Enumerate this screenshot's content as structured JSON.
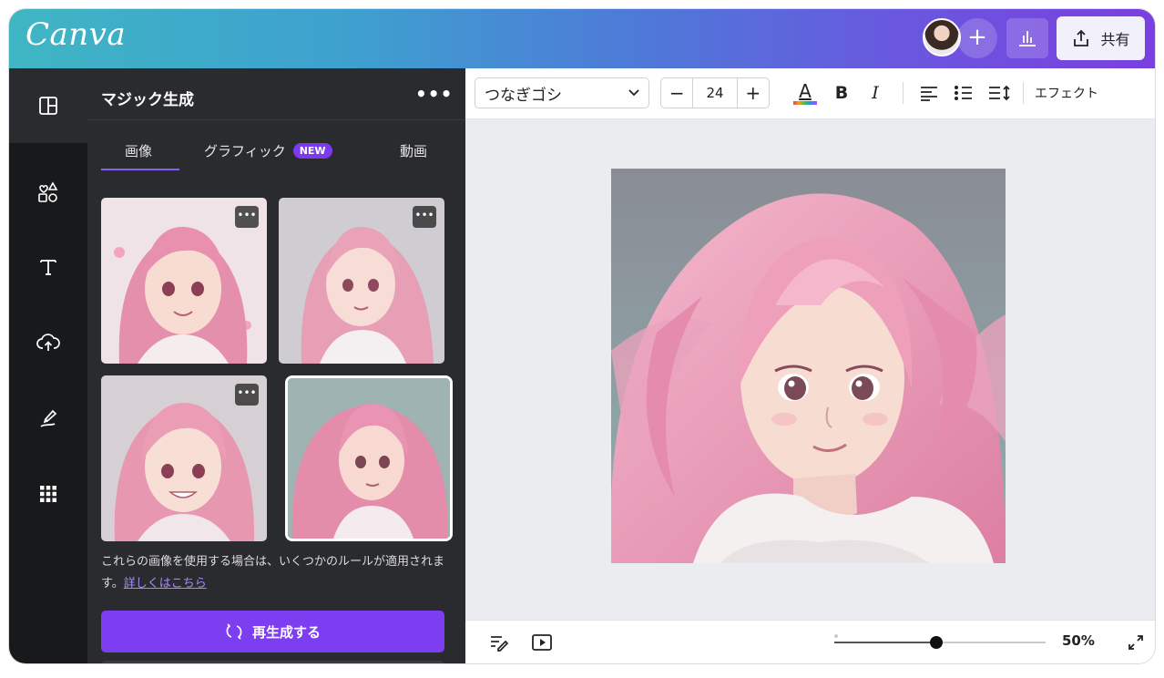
{
  "app": {
    "logo": "Canva",
    "share_label": "共有"
  },
  "panel": {
    "title": "マジック生成",
    "more": "•••",
    "tabs": [
      {
        "label": "画像"
      },
      {
        "label": "グラフィック",
        "badge": "NEW"
      },
      {
        "label": "動画"
      }
    ],
    "thumb_more": "•••",
    "disclaimer_text": "これらの画像を使用する場合は、いくつかのルールが適用されます。",
    "disclaimer_link": "詳しくはこちら",
    "regenerate_label": "再生成する"
  },
  "toolbar": {
    "font_name": "つなぎゴシ",
    "font_size": "24",
    "minus": "−",
    "plus": "+",
    "bold": "B",
    "italic": "I",
    "text_color_letter": "A",
    "effects_label": "エフェクト"
  },
  "footer": {
    "zoom": "50%",
    "zoom_fraction": 0.5
  },
  "colors": {
    "accent": "#7d3df0",
    "panel_bg": "#2a2b2e",
    "rail_bg": "#18191b"
  },
  "icons": [
    "layout-icon",
    "elements-icon",
    "text-icon",
    "upload-icon",
    "draw-icon",
    "apps-icon",
    "insights-icon",
    "share-icon",
    "notes-icon",
    "present-icon",
    "fullscreen-icon",
    "regenerate-icon"
  ]
}
